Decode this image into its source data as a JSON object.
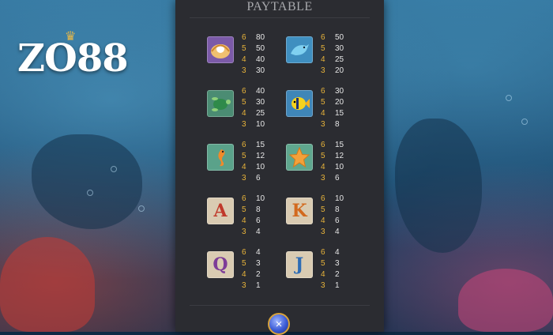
{
  "logo": {
    "text": "ZO88",
    "crown": "crown-icon"
  },
  "panel": {
    "title": "PAYTABLE"
  },
  "symbols": [
    {
      "id": "pearl-shell",
      "icon": "pearl-shell-icon",
      "bg": "#7b5aa8",
      "payouts": [
        {
          "count": "6",
          "pay": "80"
        },
        {
          "count": "5",
          "pay": "50"
        },
        {
          "count": "4",
          "pay": "40"
        },
        {
          "count": "3",
          "pay": "30"
        }
      ]
    },
    {
      "id": "dolphin",
      "icon": "dolphin-icon",
      "bg": "#3f8fc0",
      "payouts": [
        {
          "count": "6",
          "pay": "50"
        },
        {
          "count": "5",
          "pay": "30"
        },
        {
          "count": "4",
          "pay": "25"
        },
        {
          "count": "3",
          "pay": "20"
        }
      ]
    },
    {
      "id": "turtle",
      "icon": "turtle-icon",
      "bg": "#4b8c73",
      "payouts": [
        {
          "count": "6",
          "pay": "40"
        },
        {
          "count": "5",
          "pay": "30"
        },
        {
          "count": "4",
          "pay": "25"
        },
        {
          "count": "3",
          "pay": "10"
        }
      ]
    },
    {
      "id": "tropical-fish",
      "icon": "tropical-fish-icon",
      "bg": "#3f86b8",
      "payouts": [
        {
          "count": "6",
          "pay": "30"
        },
        {
          "count": "5",
          "pay": "20"
        },
        {
          "count": "4",
          "pay": "15"
        },
        {
          "count": "3",
          "pay": "8"
        }
      ]
    },
    {
      "id": "seahorse",
      "icon": "seahorse-icon",
      "bg": "#5aa28a",
      "payouts": [
        {
          "count": "6",
          "pay": "15"
        },
        {
          "count": "5",
          "pay": "12"
        },
        {
          "count": "4",
          "pay": "10"
        },
        {
          "count": "3",
          "pay": "6"
        }
      ]
    },
    {
      "id": "starfish",
      "icon": "starfish-icon",
      "bg": "#5fa78e",
      "payouts": [
        {
          "count": "6",
          "pay": "15"
        },
        {
          "count": "5",
          "pay": "12"
        },
        {
          "count": "4",
          "pay": "10"
        },
        {
          "count": "3",
          "pay": "6"
        }
      ]
    },
    {
      "id": "letter-a",
      "letter": "A",
      "icon": "letter-a-icon",
      "bg": "#d9cbb2",
      "color": "#c0392b",
      "payouts": [
        {
          "count": "6",
          "pay": "10"
        },
        {
          "count": "5",
          "pay": "8"
        },
        {
          "count": "4",
          "pay": "6"
        },
        {
          "count": "3",
          "pay": "4"
        }
      ]
    },
    {
      "id": "letter-k",
      "letter": "K",
      "icon": "letter-k-icon",
      "bg": "#d9cbb2",
      "color": "#d2691e",
      "payouts": [
        {
          "count": "6",
          "pay": "10"
        },
        {
          "count": "5",
          "pay": "8"
        },
        {
          "count": "4",
          "pay": "6"
        },
        {
          "count": "3",
          "pay": "4"
        }
      ]
    },
    {
      "id": "letter-q",
      "letter": "Q",
      "icon": "letter-q-icon",
      "bg": "#d9cbb2",
      "color": "#7d3c98",
      "payouts": [
        {
          "count": "6",
          "pay": "4"
        },
        {
          "count": "5",
          "pay": "3"
        },
        {
          "count": "4",
          "pay": "2"
        },
        {
          "count": "3",
          "pay": "1"
        }
      ]
    },
    {
      "id": "letter-j",
      "letter": "J",
      "icon": "letter-j-icon",
      "bg": "#d9cbb2",
      "color": "#2e6cb5",
      "payouts": [
        {
          "count": "6",
          "pay": "4"
        },
        {
          "count": "5",
          "pay": "3"
        },
        {
          "count": "4",
          "pay": "2"
        },
        {
          "count": "3",
          "pay": "1"
        }
      ]
    }
  ],
  "close_button": {
    "icon": "close-icon",
    "glyph": "×"
  },
  "colors": {
    "panel_bg": "#2b2c31",
    "count_color": "#e7b33a",
    "pay_color": "#e6e6e6",
    "title_color": "#a8a9ad"
  }
}
